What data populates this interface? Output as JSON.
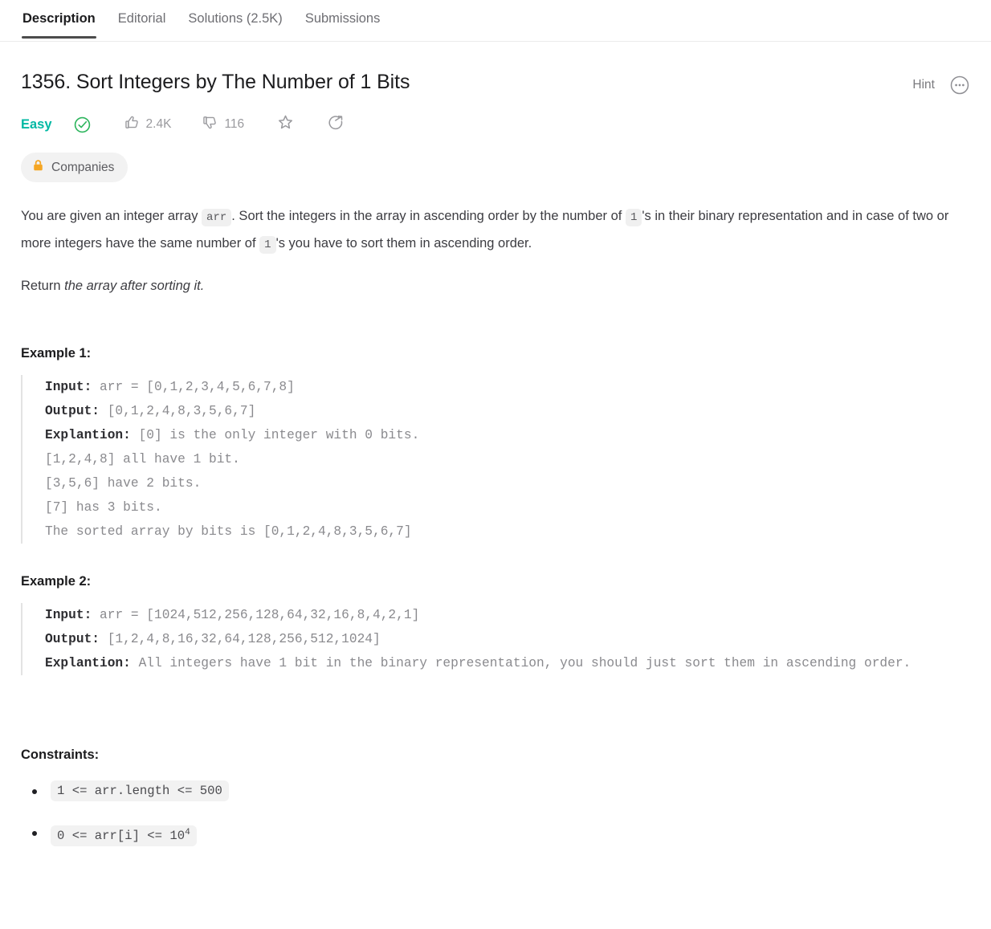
{
  "tabs": [
    {
      "label": "Description",
      "active": true
    },
    {
      "label": "Editorial",
      "active": false
    },
    {
      "label": "Solutions (2.5K)",
      "active": false
    },
    {
      "label": "Submissions",
      "active": false
    }
  ],
  "header": {
    "title": "1356. Sort Integers by The Number of 1 Bits",
    "hint_label": "Hint",
    "more_icon": "ellipsis-circle-icon"
  },
  "meta": {
    "difficulty": "Easy",
    "difficulty_color": "#00b8a3",
    "solved_icon": "check-circle-icon",
    "solved_color": "#2db55d",
    "upvotes": "2.4K",
    "upvote_icon": "thumbs-up-icon",
    "downvotes": "116",
    "downvote_icon": "thumbs-down-icon",
    "favorite_icon": "star-icon",
    "share_icon": "share-icon"
  },
  "companies": {
    "label": "Companies",
    "lock_icon": "lock-icon",
    "lock_color": "#f5a623"
  },
  "description": {
    "p1_a": "You are given an integer array ",
    "p1_code1": "arr",
    "p1_b": ". Sort the integers in the array in ascending order by the number of ",
    "p1_code2": "1",
    "p1_c": "'s in their binary representation and in case of two or more integers have the same number of ",
    "p1_code3": "1",
    "p1_d": "'s you have to sort them in ascending order.",
    "p2_a": "Return ",
    "p2_italic": "the array after sorting it."
  },
  "examples": [
    {
      "heading": "Example 1:",
      "input_label": "Input:",
      "input_value": " arr = [0,1,2,3,4,5,6,7,8]",
      "output_label": "Output:",
      "output_value": " [0,1,2,4,8,3,5,6,7]",
      "explanation_label": "Explantion:",
      "explanation_value": " [0] is the only integer with 0 bits.\n[1,2,4,8] all have 1 bit.\n[3,5,6] have 2 bits.\n[7] has 3 bits.\nThe sorted array by bits is [0,1,2,4,8,3,5,6,7]"
    },
    {
      "heading": "Example 2:",
      "input_label": "Input:",
      "input_value": " arr = [1024,512,256,128,64,32,16,8,4,2,1]",
      "output_label": "Output:",
      "output_value": " [1,2,4,8,16,32,64,128,256,512,1024]",
      "explanation_label": "Explantion:",
      "explanation_value": " All integers have 1 bit in the binary representation, you should just sort them in ascending order."
    }
  ],
  "constraints": {
    "heading": "Constraints:",
    "items": [
      {
        "text": "1 <= arr.length <= 500",
        "sup": ""
      },
      {
        "text": "0 <= arr[i] <= 10",
        "sup": "4"
      }
    ]
  }
}
